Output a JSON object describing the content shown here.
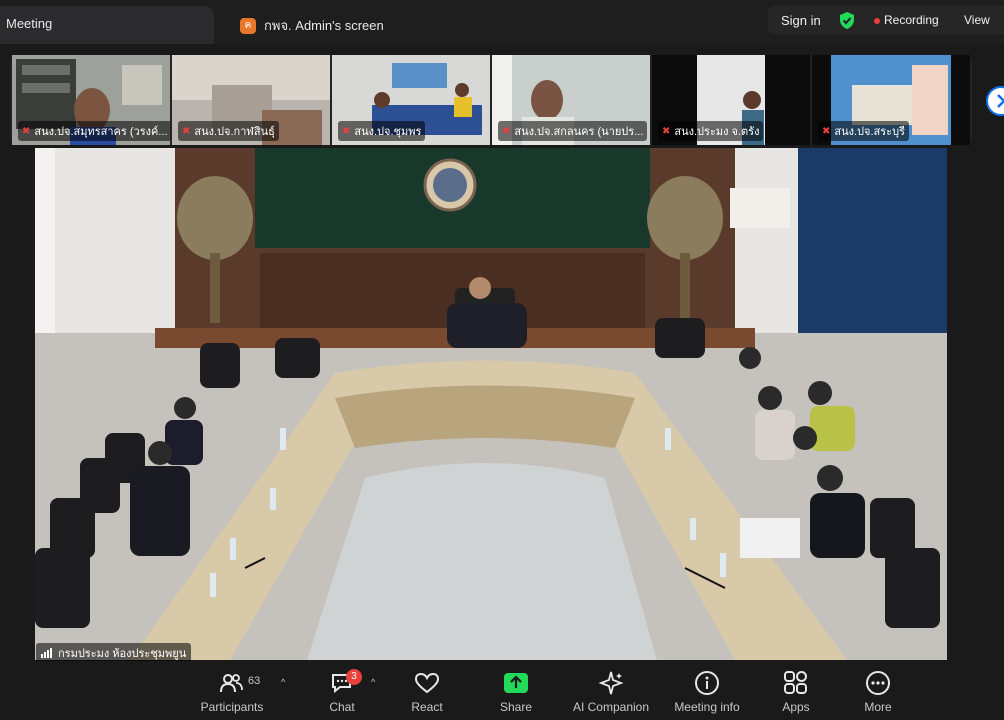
{
  "window": {
    "tab_active": "Meeting",
    "tab_screen": {
      "icon_letter": "ค",
      "label": "กพจ. Admin's screen"
    },
    "sign_in": "Sign in",
    "recording": "Recording",
    "view": "View"
  },
  "participants_strip": [
    {
      "name": "สนง.ปจ.สมุทรสาคร (วรงค์..."
    },
    {
      "name": "สนง.ปจ.กาฬสินธุ์"
    },
    {
      "name": "สนง.ปจ.ชุมพร"
    },
    {
      "name": "สนง.ปจ.สกลนคร (นายปร..."
    },
    {
      "name": "สนง.ประมง จ.ตรัง"
    },
    {
      "name": "สนง.ปจ.สระบุรี"
    }
  ],
  "main_video": {
    "name": "กรมประมง ห้องประชุมพยูน"
  },
  "toolbar": {
    "participants": {
      "label": "Participants",
      "count": "63"
    },
    "chat": {
      "label": "Chat",
      "badge": "3"
    },
    "react": {
      "label": "React"
    },
    "share": {
      "label": "Share"
    },
    "ai": {
      "label": "AI Companion"
    },
    "info": {
      "label": "Meeting info"
    },
    "apps": {
      "label": "Apps"
    },
    "more": {
      "label": "More"
    }
  },
  "colors": {
    "accent": "#0e72ed",
    "share_green": "#23d959",
    "recording_red": "#e8403a",
    "shield_green": "#23d959"
  }
}
